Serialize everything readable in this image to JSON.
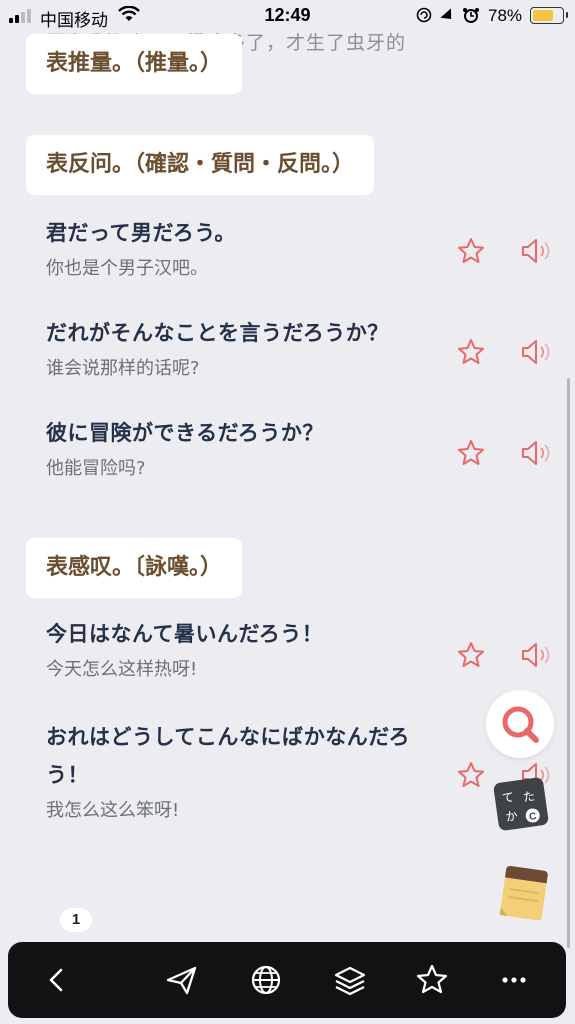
{
  "status_bar": {
    "carrier": "中国移动",
    "time": "12:49",
    "battery_percent": "78%"
  },
  "faded_text": "因为我饰吃了吗得这多了，才生了虫牙的",
  "sections": [
    {
      "heading": "表推量。（推量。）"
    },
    {
      "heading": "表反问。（確認・質問・反問。）",
      "items": [
        {
          "jp": "君だって男だろう。",
          "cn": "你也是个男子汉吧。"
        },
        {
          "jp": "だれがそんなことを言うだろうか？",
          "cn": "谁会说那样的话呢?"
        },
        {
          "jp": "彼に冒険ができるだろうか？",
          "cn": "他能冒险吗?"
        }
      ]
    },
    {
      "heading": "表感叹。〔詠嘆。）",
      "items": [
        {
          "jp": "今日はなんて暑いんだろう！",
          "cn": "今天怎么这样热呀!"
        },
        {
          "jp": "おれはどうしてこんなにばかなんだろう！",
          "cn": "我怎么这么笨呀!"
        }
      ]
    }
  ],
  "kana_button": {
    "k1": "て",
    "k2": "た",
    "k3": "か",
    "k4": "C"
  },
  "page_badge": "1",
  "colors": {
    "accent": "#e8686b",
    "heading_text": "#6b4e2f",
    "toolbar_bg": "#111214"
  }
}
